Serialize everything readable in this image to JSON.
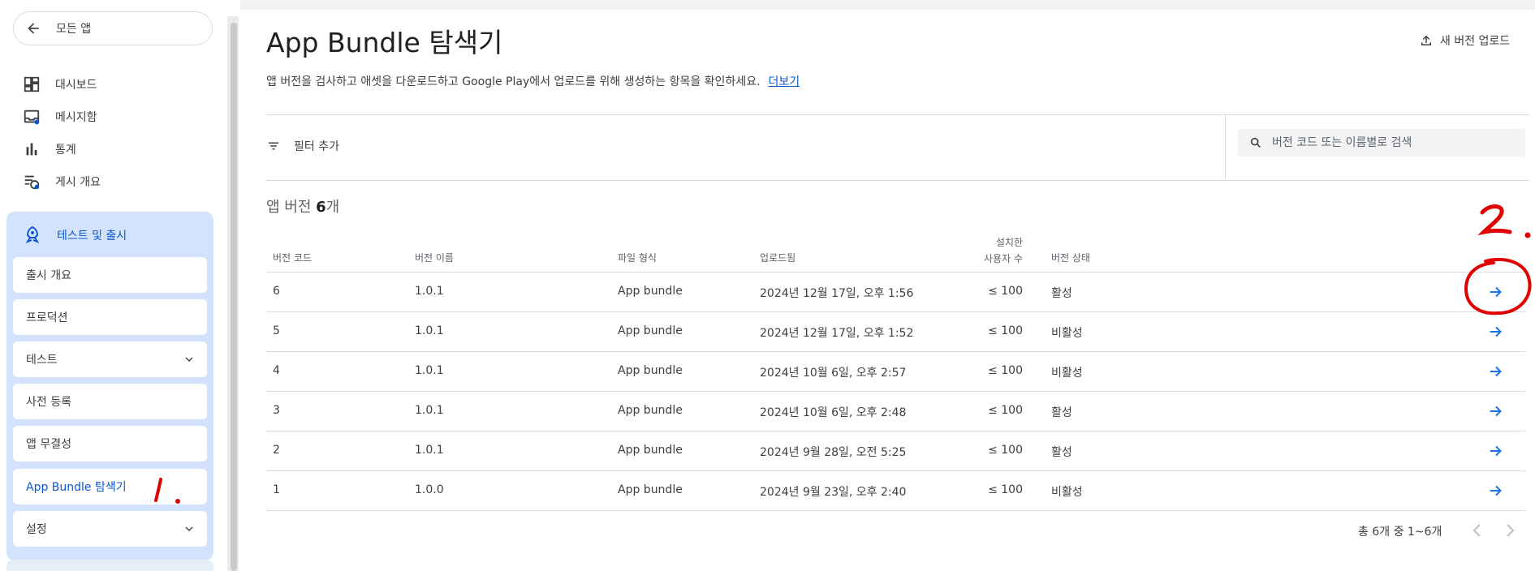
{
  "sidebar": {
    "back_label": "모든 앱",
    "items": [
      {
        "label": "대시보드",
        "icon": "dashboard-icon"
      },
      {
        "label": "메시지함",
        "icon": "inbox-icon"
      },
      {
        "label": "통계",
        "icon": "bar-chart-icon"
      },
      {
        "label": "게시 개요",
        "icon": "publishing-overview-icon"
      }
    ],
    "group_label": "테스트 및 출시",
    "sub_items": [
      {
        "label": "출시 개요"
      },
      {
        "label": "프로덕션"
      },
      {
        "label": "테스트"
      },
      {
        "label": "사전 등록"
      },
      {
        "label": "앱 무결성"
      },
      {
        "label": "App Bundle 탐색기"
      },
      {
        "label": "설정"
      }
    ]
  },
  "header": {
    "title": "App Bundle 탐색기",
    "upload_label": "새 버전 업로드",
    "subtitle": "앱 버전을 검사하고 애셋을 다운로드하고 Google Play에서 업로드를 위해 생성하는 항목을 확인하세요.",
    "more_link": "더보기"
  },
  "toolbar": {
    "filter_label": "필터 추가",
    "search_placeholder": "버전 코드 또는 이름별로 검색"
  },
  "summary": {
    "prefix": "앱 버전 ",
    "count": "6",
    "suffix": "개"
  },
  "table": {
    "headers": {
      "code": "버전 코드",
      "name": "버전 이름",
      "format": "파일 형식",
      "uploaded": "업로드됨",
      "installed_1": "설치한",
      "installed_2": "사용자 수",
      "status": "버전 상태"
    },
    "rows": [
      {
        "code": "6",
        "name": "1.0.1",
        "format": "App bundle",
        "uploaded": "2024년 12월 17일, 오후 1:56",
        "installs": "≤ 100",
        "status": "활성"
      },
      {
        "code": "5",
        "name": "1.0.1",
        "format": "App bundle",
        "uploaded": "2024년 12월 17일, 오후 1:52",
        "installs": "≤ 100",
        "status": "비활성"
      },
      {
        "code": "4",
        "name": "1.0.1",
        "format": "App bundle",
        "uploaded": "2024년 10월 6일, 오후 2:57",
        "installs": "≤ 100",
        "status": "비활성"
      },
      {
        "code": "3",
        "name": "1.0.1",
        "format": "App bundle",
        "uploaded": "2024년 10월 6일, 오후 2:48",
        "installs": "≤ 100",
        "status": "활성"
      },
      {
        "code": "2",
        "name": "1.0.1",
        "format": "App bundle",
        "uploaded": "2024년 9월 28일, 오전 5:25",
        "installs": "≤ 100",
        "status": "활성"
      },
      {
        "code": "1",
        "name": "1.0.0",
        "format": "App bundle",
        "uploaded": "2024년 9월 23일, 오후 2:40",
        "installs": "≤ 100",
        "status": "비활성"
      }
    ]
  },
  "pagination": {
    "label": "총 6개 중 1~6개"
  },
  "annotations": {
    "mark_1": "1.",
    "mark_2": "2."
  },
  "colors": {
    "accent": "#0b57d0",
    "group_bg": "#d3e3fd",
    "arrow": "#1a73e8",
    "annotation": "#e00000"
  }
}
